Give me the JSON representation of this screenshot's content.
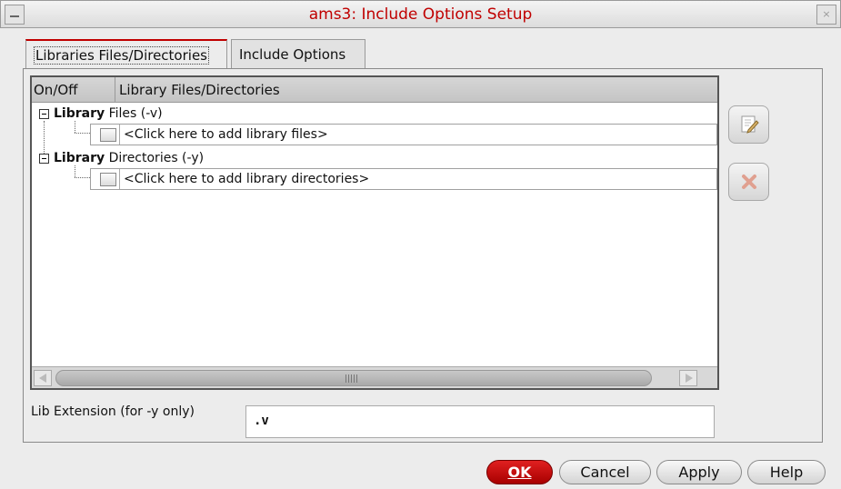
{
  "window": {
    "title": "ams3: Include Options Setup",
    "close_glyph": "×"
  },
  "tabs": [
    {
      "label": "Libraries Files/Directories",
      "active": true
    },
    {
      "label": "Include Options",
      "active": false
    }
  ],
  "tree": {
    "headers": [
      "On/Off",
      "Library Files/Directories"
    ],
    "groups": [
      {
        "bold": "Library",
        "rest": " Files (-v)",
        "child": "<Click here to add library files>"
      },
      {
        "bold": "Library",
        "rest": " Directories (-y)",
        "child": "<Click here to add library directories>"
      }
    ]
  },
  "tools": [
    {
      "icon": "edit-icon"
    },
    {
      "icon": "delete-icon"
    }
  ],
  "lib_extension": {
    "label": "Lib Extension (for -y only)",
    "value": ".v"
  },
  "buttons": {
    "ok": "OK",
    "cancel": "Cancel",
    "apply": "Apply",
    "help": "Help"
  },
  "colors": {
    "accent": "#c00000"
  }
}
